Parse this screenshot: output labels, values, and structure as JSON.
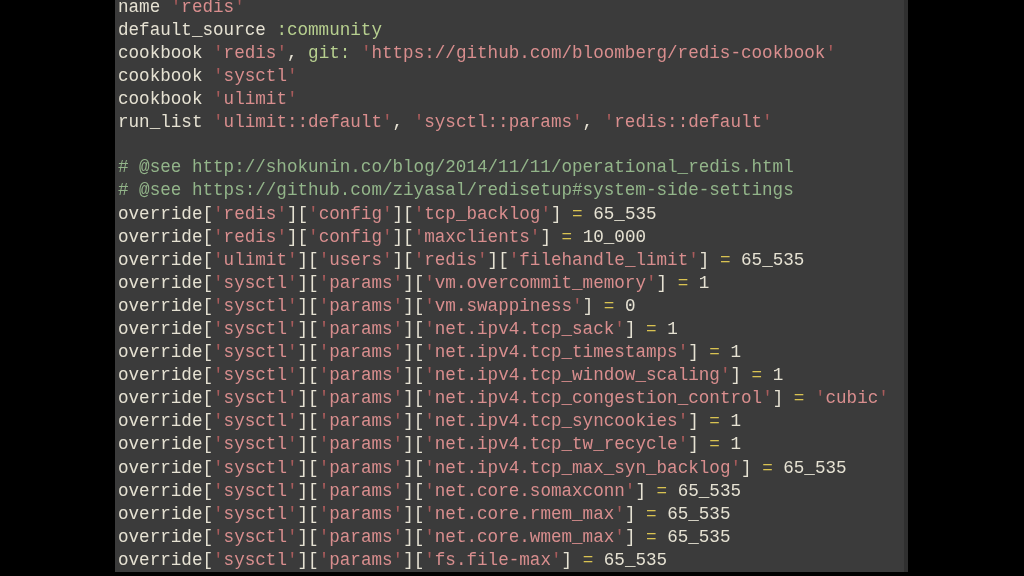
{
  "editor": {
    "lines": [
      {
        "kind": "code",
        "tokens": [
          {
            "kind": "text",
            "text": "name "
          },
          {
            "kind": "string",
            "text": "'redis'"
          }
        ]
      },
      {
        "kind": "code",
        "tokens": [
          {
            "kind": "text",
            "text": "default_source "
          },
          {
            "kind": "symbol",
            "text": ":community"
          }
        ]
      },
      {
        "kind": "code",
        "tokens": [
          {
            "kind": "text",
            "text": "cookbook "
          },
          {
            "kind": "string",
            "text": "'redis'"
          },
          {
            "kind": "text",
            "text": ", "
          },
          {
            "kind": "symbol",
            "text": "git: "
          },
          {
            "kind": "string",
            "text": "'https://github.com/bloomberg/redis-cookbook'"
          }
        ]
      },
      {
        "kind": "code",
        "tokens": [
          {
            "kind": "text",
            "text": "cookbook "
          },
          {
            "kind": "string",
            "text": "'sysctl'"
          }
        ]
      },
      {
        "kind": "code",
        "tokens": [
          {
            "kind": "text",
            "text": "cookbook "
          },
          {
            "kind": "string",
            "text": "'ulimit'"
          }
        ]
      },
      {
        "kind": "code",
        "tokens": [
          {
            "kind": "text",
            "text": "run_list "
          },
          {
            "kind": "string",
            "text": "'ulimit::default'"
          },
          {
            "kind": "text",
            "text": ", "
          },
          {
            "kind": "string",
            "text": "'sysctl::params'"
          },
          {
            "kind": "text",
            "text": ", "
          },
          {
            "kind": "string",
            "text": "'redis::default'"
          }
        ]
      },
      {
        "kind": "blank"
      },
      {
        "kind": "code",
        "tokens": [
          {
            "kind": "comment",
            "text": "# @see http://shokunin.co/blog/2014/11/11/operational_redis.html"
          }
        ]
      },
      {
        "kind": "code",
        "tokens": [
          {
            "kind": "comment",
            "text": "# @see https://github.com/ziyasal/redisetup#system-side-settings"
          }
        ]
      },
      {
        "kind": "code",
        "tokens": [
          {
            "kind": "text",
            "text": "override["
          },
          {
            "kind": "string",
            "text": "'redis'"
          },
          {
            "kind": "text",
            "text": "]["
          },
          {
            "kind": "string",
            "text": "'config'"
          },
          {
            "kind": "text",
            "text": "]["
          },
          {
            "kind": "string",
            "text": "'tcp_backlog'"
          },
          {
            "kind": "text",
            "text": "] "
          },
          {
            "kind": "operator",
            "text": "= "
          },
          {
            "kind": "text",
            "text": "65_535"
          }
        ]
      },
      {
        "kind": "code",
        "tokens": [
          {
            "kind": "text",
            "text": "override["
          },
          {
            "kind": "string",
            "text": "'redis'"
          },
          {
            "kind": "text",
            "text": "]["
          },
          {
            "kind": "string",
            "text": "'config'"
          },
          {
            "kind": "text",
            "text": "]["
          },
          {
            "kind": "string",
            "text": "'maxclients'"
          },
          {
            "kind": "text",
            "text": "] "
          },
          {
            "kind": "operator",
            "text": "= "
          },
          {
            "kind": "text",
            "text": "10_000"
          }
        ]
      },
      {
        "kind": "code",
        "tokens": [
          {
            "kind": "text",
            "text": "override["
          },
          {
            "kind": "string",
            "text": "'ulimit'"
          },
          {
            "kind": "text",
            "text": "]["
          },
          {
            "kind": "string",
            "text": "'users'"
          },
          {
            "kind": "text",
            "text": "]["
          },
          {
            "kind": "string",
            "text": "'redis'"
          },
          {
            "kind": "text",
            "text": "]["
          },
          {
            "kind": "string",
            "text": "'filehandle_limit'"
          },
          {
            "kind": "text",
            "text": "] "
          },
          {
            "kind": "operator",
            "text": "= "
          },
          {
            "kind": "text",
            "text": "65_535"
          }
        ]
      },
      {
        "kind": "code",
        "tokens": [
          {
            "kind": "text",
            "text": "override["
          },
          {
            "kind": "string",
            "text": "'sysctl'"
          },
          {
            "kind": "text",
            "text": "]["
          },
          {
            "kind": "string",
            "text": "'params'"
          },
          {
            "kind": "text",
            "text": "]["
          },
          {
            "kind": "string",
            "text": "'vm.overcommit_memory'"
          },
          {
            "kind": "text",
            "text": "] "
          },
          {
            "kind": "operator",
            "text": "= "
          },
          {
            "kind": "text",
            "text": "1"
          }
        ]
      },
      {
        "kind": "code",
        "tokens": [
          {
            "kind": "text",
            "text": "override["
          },
          {
            "kind": "string",
            "text": "'sysctl'"
          },
          {
            "kind": "text",
            "text": "]["
          },
          {
            "kind": "string",
            "text": "'params'"
          },
          {
            "kind": "text",
            "text": "]["
          },
          {
            "kind": "string",
            "text": "'vm.swappiness'"
          },
          {
            "kind": "text",
            "text": "] "
          },
          {
            "kind": "operator",
            "text": "= "
          },
          {
            "kind": "text",
            "text": "0"
          }
        ]
      },
      {
        "kind": "code",
        "tokens": [
          {
            "kind": "text",
            "text": "override["
          },
          {
            "kind": "string",
            "text": "'sysctl'"
          },
          {
            "kind": "text",
            "text": "]["
          },
          {
            "kind": "string",
            "text": "'params'"
          },
          {
            "kind": "text",
            "text": "]["
          },
          {
            "kind": "string",
            "text": "'net.ipv4.tcp_sack'"
          },
          {
            "kind": "text",
            "text": "] "
          },
          {
            "kind": "operator",
            "text": "= "
          },
          {
            "kind": "text",
            "text": "1"
          }
        ]
      },
      {
        "kind": "code",
        "tokens": [
          {
            "kind": "text",
            "text": "override["
          },
          {
            "kind": "string",
            "text": "'sysctl'"
          },
          {
            "kind": "text",
            "text": "]["
          },
          {
            "kind": "string",
            "text": "'params'"
          },
          {
            "kind": "text",
            "text": "]["
          },
          {
            "kind": "string",
            "text": "'net.ipv4.tcp_timestamps'"
          },
          {
            "kind": "text",
            "text": "] "
          },
          {
            "kind": "operator",
            "text": "= "
          },
          {
            "kind": "text",
            "text": "1"
          }
        ]
      },
      {
        "kind": "code",
        "tokens": [
          {
            "kind": "text",
            "text": "override["
          },
          {
            "kind": "string",
            "text": "'sysctl'"
          },
          {
            "kind": "text",
            "text": "]["
          },
          {
            "kind": "string",
            "text": "'params'"
          },
          {
            "kind": "text",
            "text": "]["
          },
          {
            "kind": "string",
            "text": "'net.ipv4.tcp_window_scaling'"
          },
          {
            "kind": "text",
            "text": "] "
          },
          {
            "kind": "operator",
            "text": "= "
          },
          {
            "kind": "text",
            "text": "1"
          }
        ]
      },
      {
        "kind": "code",
        "tokens": [
          {
            "kind": "text",
            "text": "override["
          },
          {
            "kind": "string",
            "text": "'sysctl'"
          },
          {
            "kind": "text",
            "text": "]["
          },
          {
            "kind": "string",
            "text": "'params'"
          },
          {
            "kind": "text",
            "text": "]["
          },
          {
            "kind": "string",
            "text": "'net.ipv4.tcp_congestion_control'"
          },
          {
            "kind": "text",
            "text": "] "
          },
          {
            "kind": "operator",
            "text": "= "
          },
          {
            "kind": "string",
            "text": "'cubic'"
          }
        ]
      },
      {
        "kind": "code",
        "tokens": [
          {
            "kind": "text",
            "text": "override["
          },
          {
            "kind": "string",
            "text": "'sysctl'"
          },
          {
            "kind": "text",
            "text": "]["
          },
          {
            "kind": "string",
            "text": "'params'"
          },
          {
            "kind": "text",
            "text": "]["
          },
          {
            "kind": "string",
            "text": "'net.ipv4.tcp_syncookies'"
          },
          {
            "kind": "text",
            "text": "] "
          },
          {
            "kind": "operator",
            "text": "= "
          },
          {
            "kind": "text",
            "text": "1"
          }
        ]
      },
      {
        "kind": "code",
        "tokens": [
          {
            "kind": "text",
            "text": "override["
          },
          {
            "kind": "string",
            "text": "'sysctl'"
          },
          {
            "kind": "text",
            "text": "]["
          },
          {
            "kind": "string",
            "text": "'params'"
          },
          {
            "kind": "text",
            "text": "]["
          },
          {
            "kind": "string",
            "text": "'net.ipv4.tcp_tw_recycle'"
          },
          {
            "kind": "text",
            "text": "] "
          },
          {
            "kind": "operator",
            "text": "= "
          },
          {
            "kind": "text",
            "text": "1"
          }
        ]
      },
      {
        "kind": "code",
        "tokens": [
          {
            "kind": "text",
            "text": "override["
          },
          {
            "kind": "string",
            "text": "'sysctl'"
          },
          {
            "kind": "text",
            "text": "]["
          },
          {
            "kind": "string",
            "text": "'params'"
          },
          {
            "kind": "text",
            "text": "]["
          },
          {
            "kind": "string",
            "text": "'net.ipv4.tcp_max_syn_backlog'"
          },
          {
            "kind": "text",
            "text": "] "
          },
          {
            "kind": "operator",
            "text": "= "
          },
          {
            "kind": "text",
            "text": "65_535"
          }
        ]
      },
      {
        "kind": "code",
        "tokens": [
          {
            "kind": "text",
            "text": "override["
          },
          {
            "kind": "string",
            "text": "'sysctl'"
          },
          {
            "kind": "text",
            "text": "]["
          },
          {
            "kind": "string",
            "text": "'params'"
          },
          {
            "kind": "text",
            "text": "]["
          },
          {
            "kind": "string",
            "text": "'net.core.somaxconn'"
          },
          {
            "kind": "text",
            "text": "] "
          },
          {
            "kind": "operator",
            "text": "= "
          },
          {
            "kind": "text",
            "text": "65_535"
          }
        ]
      },
      {
        "kind": "code",
        "tokens": [
          {
            "kind": "text",
            "text": "override["
          },
          {
            "kind": "string",
            "text": "'sysctl'"
          },
          {
            "kind": "text",
            "text": "]["
          },
          {
            "kind": "string",
            "text": "'params'"
          },
          {
            "kind": "text",
            "text": "]["
          },
          {
            "kind": "string",
            "text": "'net.core.rmem_max'"
          },
          {
            "kind": "text",
            "text": "] "
          },
          {
            "kind": "operator",
            "text": "= "
          },
          {
            "kind": "text",
            "text": "65_535"
          }
        ]
      },
      {
        "kind": "code",
        "tokens": [
          {
            "kind": "text",
            "text": "override["
          },
          {
            "kind": "string",
            "text": "'sysctl'"
          },
          {
            "kind": "text",
            "text": "]["
          },
          {
            "kind": "string",
            "text": "'params'"
          },
          {
            "kind": "text",
            "text": "]["
          },
          {
            "kind": "string",
            "text": "'net.core.wmem_max'"
          },
          {
            "kind": "text",
            "text": "] "
          },
          {
            "kind": "operator",
            "text": "= "
          },
          {
            "kind": "text",
            "text": "65_535"
          }
        ]
      },
      {
        "kind": "code",
        "tokens": [
          {
            "kind": "text",
            "text": "override["
          },
          {
            "kind": "string",
            "text": "'sysctl'"
          },
          {
            "kind": "text",
            "text": "]["
          },
          {
            "kind": "string",
            "text": "'params'"
          },
          {
            "kind": "text",
            "text": "]["
          },
          {
            "kind": "string",
            "text": "'fs.file-max'"
          },
          {
            "kind": "text",
            "text": "] "
          },
          {
            "kind": "operator",
            "text": "= "
          },
          {
            "kind": "text",
            "text": "65_535"
          }
        ]
      }
    ]
  }
}
